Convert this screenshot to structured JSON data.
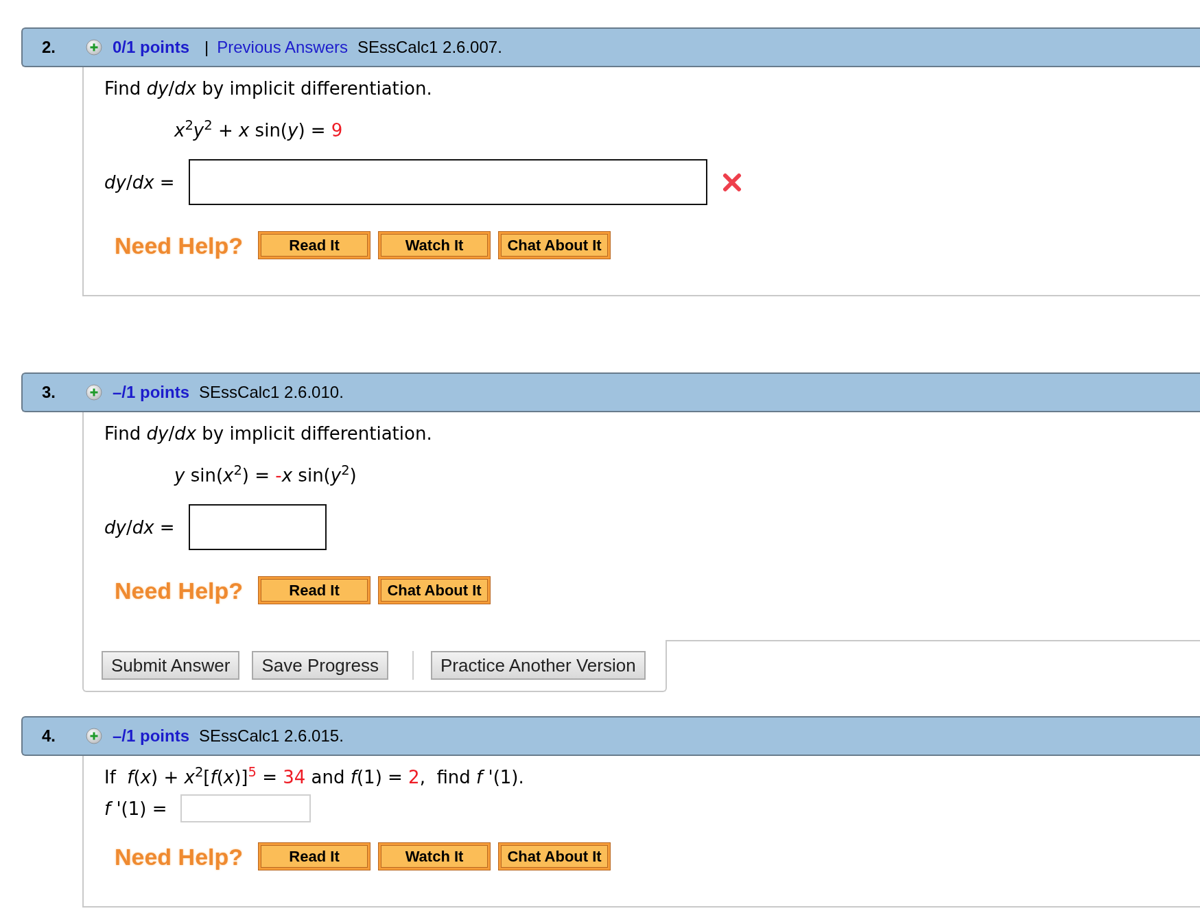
{
  "questions": [
    {
      "number": "2.",
      "points": "0/1 points",
      "divider": "|",
      "link": "Previous Answers",
      "source": "SEssCalc1 2.6.007.",
      "prompt": [
        {
          "text": "Find *dy*/*dx* by implicit differentiation.",
          "highlighted": false
        }
      ],
      "equation": [
        {
          "text": "*x*$^{2}$*y*$^{2}$ + *x* sin(*y*) = ",
          "highlighted": false
        },
        {
          "text": "9",
          "highlighted": true
        }
      ],
      "answer": {
        "label": "*dy*/*dx* =",
        "kind": "math",
        "wide": true,
        "incorrect": true
      },
      "help": {
        "label": "Need Help?",
        "buttons": [
          "Read It",
          "Watch It",
          "Chat About It"
        ]
      }
    },
    {
      "number": "3.",
      "points": "–/1 points",
      "source": "SEssCalc1 2.6.010.",
      "prompt": [
        {
          "text": "Find *dy*/*dx* by implicit differentiation.",
          "highlighted": false
        }
      ],
      "equation": [
        {
          "text": "*y* sin(*x*$^{2}$) = ",
          "highlighted": false
        },
        {
          "text": "-",
          "highlighted": true
        },
        {
          "text": "*x* sin(*y*$^{2}$)",
          "highlighted": false
        }
      ],
      "answer": {
        "label": "*dy*/*dx* =",
        "kind": "math",
        "wide": false,
        "incorrect": false
      },
      "help": {
        "label": "Need Help?",
        "buttons": [
          "Read It",
          "Chat About It"
        ]
      },
      "action_groups": [
        [
          "Submit Answer",
          "Save Progress"
        ],
        [
          "Practice Another Version"
        ]
      ]
    },
    {
      "number": "4.",
      "points": "–/1 points",
      "source": "SEssCalc1 2.6.015.",
      "prompt": [
        {
          "text": "If  *f*(*x*) + *x*$^{2}$[*f*(*x*)]",
          "highlighted": false
        },
        {
          "text": "$^{5}$",
          "highlighted": true
        },
        {
          "text": " = ",
          "highlighted": false
        },
        {
          "text": "34",
          "highlighted": true
        },
        {
          "text": " and *f*(1) = ",
          "highlighted": false
        },
        {
          "text": "2",
          "highlighted": true
        },
        {
          "text": ",  find *f* '(1).",
          "highlighted": false
        }
      ],
      "answer": {
        "label": "*f* '(1) =",
        "kind": "text",
        "wide": false,
        "incorrect": false
      },
      "help": {
        "label": "Need Help?",
        "buttons": [
          "Read It",
          "Watch It",
          "Chat About It"
        ]
      }
    }
  ]
}
